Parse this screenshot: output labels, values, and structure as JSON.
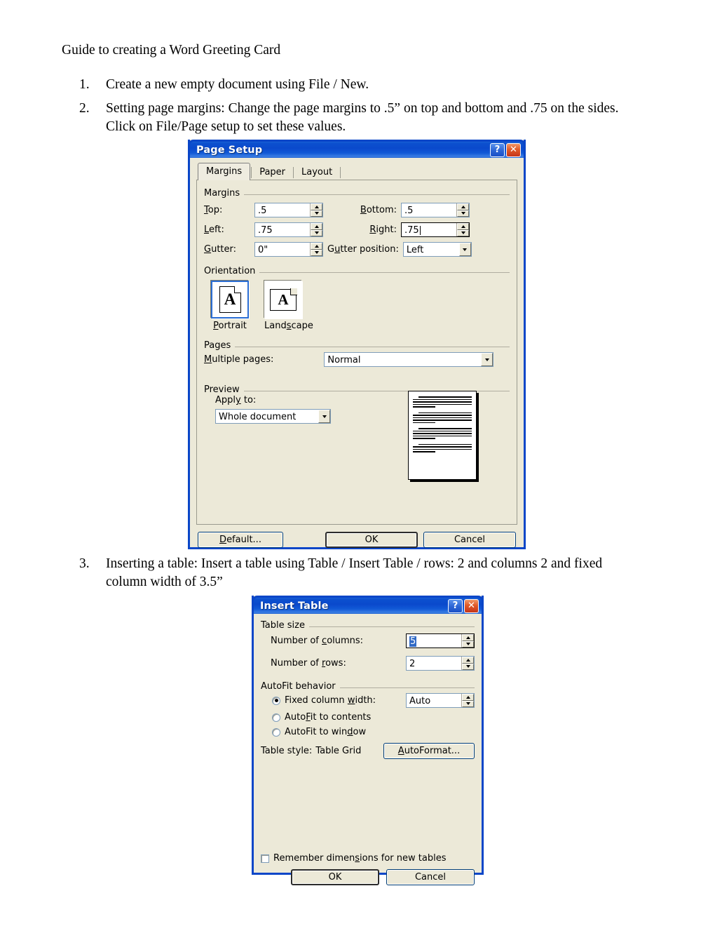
{
  "document": {
    "title": "Guide to creating a Word Greeting Card",
    "steps": [
      {
        "number": "1.",
        "text": "Create a new empty document using File / New."
      },
      {
        "number": "2.",
        "text": "Setting page margins: Change the page margins to .5” on top and bottom and .75 on the sides. Click on File/Page setup to set these values."
      },
      {
        "number": "3.",
        "text": "Inserting a table: Insert a table using Table / Insert Table / rows: 2 and columns 2 and fixed column width of 3.5”"
      }
    ]
  },
  "page_setup_dialog": {
    "title": "Page Setup",
    "help_button": "?",
    "close_button": "✕",
    "tabs": [
      {
        "label": "Margins",
        "active": true
      },
      {
        "label": "Paper",
        "active": false
      },
      {
        "label": "Layout",
        "active": false
      }
    ],
    "margins_group": {
      "label": "Margins",
      "top_label": "Top:",
      "top_value": ".5",
      "bottom_label": "Bottom:",
      "bottom_value": ".5",
      "left_label": "Left:",
      "left_value": ".75",
      "right_label": "Right:",
      "right_value": ".75",
      "gutter_label": "Gutter:",
      "gutter_value": "0\"",
      "gutter_position_label": "Gutter position:",
      "gutter_position_value": "Left"
    },
    "orientation_group": {
      "label": "Orientation",
      "portrait_label": "Portrait",
      "landscape_label": "Landscape",
      "icon_letter": "A",
      "selected": "Portrait"
    },
    "pages_group": {
      "label": "Pages",
      "multiple_pages_label": "Multiple pages:",
      "multiple_pages_value": "Normal"
    },
    "preview_group": {
      "label": "Preview",
      "apply_to_label": "Apply to:",
      "apply_to_value": "Whole document"
    },
    "buttons": {
      "default": "Default...",
      "ok": "OK",
      "cancel": "Cancel"
    }
  },
  "insert_table_dialog": {
    "title": "Insert Table",
    "help_button": "?",
    "close_button": "✕",
    "table_size_group": {
      "label": "Table size",
      "columns_label": "Number of columns:",
      "columns_value": "5",
      "rows_label": "Number of rows:",
      "rows_value": "2"
    },
    "autofit_group": {
      "label": "AutoFit behavior",
      "fixed_width_label": "Fixed column width:",
      "fixed_width_value": "Auto",
      "autofit_contents_label": "AutoFit to contents",
      "autofit_window_label": "AutoFit to window",
      "selected": "Fixed column width"
    },
    "table_style_label": "Table style:",
    "table_style_value": "Table Grid",
    "autoformat_button": "AutoFormat...",
    "remember_checkbox_label": "Remember dimensions for new tables",
    "remember_checked": false,
    "buttons": {
      "ok": "OK",
      "cancel": "Cancel"
    }
  },
  "colors": {
    "titlebar_blue": "#0a46c8",
    "dialog_face": "#ece9d8",
    "selection_blue": "#316ac5",
    "close_red": "#e05a28"
  }
}
